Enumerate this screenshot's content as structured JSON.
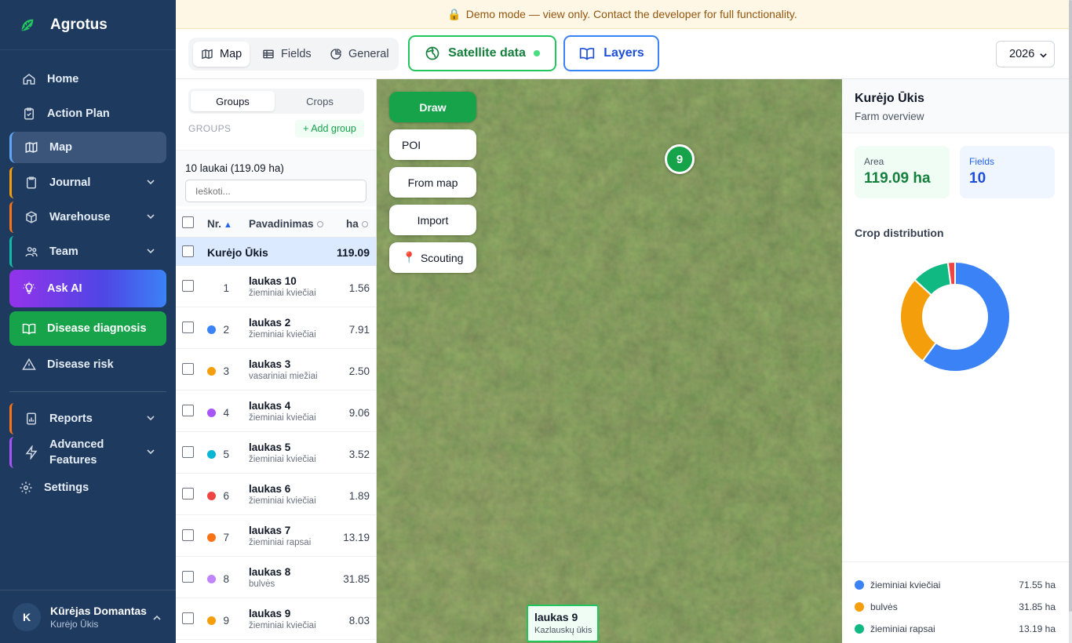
{
  "app": {
    "name": "Agrotus"
  },
  "banner": {
    "text": "Demo mode — view only. Contact the developer for full functionality."
  },
  "sidebar": {
    "items": [
      {
        "label": "Home",
        "icon": "home-icon"
      },
      {
        "label": "Action Plan",
        "icon": "clipboard-icon"
      },
      {
        "label": "Map",
        "icon": "map-icon"
      },
      {
        "label": "Journal",
        "icon": "clipboard-icon"
      },
      {
        "label": "Warehouse",
        "icon": "box-icon"
      },
      {
        "label": "Team",
        "icon": "users-icon"
      },
      {
        "label": "Ask AI",
        "icon": "bulb-icon"
      },
      {
        "label": "Disease diagnosis",
        "icon": "book-icon"
      },
      {
        "label": "Disease risk",
        "icon": "warning-icon"
      },
      {
        "label": "Reports",
        "icon": "report-icon"
      },
      {
        "label": "Advanced",
        "label2": "Features",
        "icon": "bolt-icon"
      },
      {
        "label": "Settings",
        "icon": "gear-icon"
      }
    ],
    "active": "Map"
  },
  "user": {
    "initial": "K",
    "name": "Kūrėjas Domantas",
    "farm": "Kurėjo Ūkis"
  },
  "toolbar": {
    "tabs": [
      {
        "label": "Map"
      },
      {
        "label": "Fields"
      },
      {
        "label": "General"
      }
    ],
    "active_tab": "Map",
    "satellite_label": "Satellite data",
    "layers_label": "Layers",
    "year": "2026"
  },
  "fields_panel": {
    "seg_groups": "Groups",
    "seg_crops": "Crops",
    "groups_label": "GROUPS",
    "add_group": "+ Add group",
    "summary": "10 laukai (119.09 ha)",
    "search_placeholder": "Ieškoti...",
    "headers": {
      "nr": "Nr.",
      "name": "Pavadinimas",
      "ha": "ha"
    },
    "farm_row": {
      "name": "Kurėjo Ūkis",
      "ha": "119.09"
    },
    "rows": [
      {
        "nr": "1",
        "name": "laukas 10",
        "crop": "žieminiai kviečiai",
        "ha": "1.56",
        "color": ""
      },
      {
        "nr": "2",
        "name": "laukas 2",
        "crop": "žieminiai kviečiai",
        "ha": "7.91",
        "color": "#3b82f6"
      },
      {
        "nr": "3",
        "name": "laukas 3",
        "crop": "vasariniai miežiai",
        "ha": "2.50",
        "color": "#f59e0b"
      },
      {
        "nr": "4",
        "name": "laukas 4",
        "crop": "žieminiai kviečiai",
        "ha": "9.06",
        "color": "#a855f7"
      },
      {
        "nr": "5",
        "name": "laukas 5",
        "crop": "žieminiai kviečiai",
        "ha": "3.52",
        "color": "#06b6d4"
      },
      {
        "nr": "6",
        "name": "laukas 6",
        "crop": "žieminiai kviečiai",
        "ha": "1.89",
        "color": "#ef4444"
      },
      {
        "nr": "7",
        "name": "laukas 7",
        "crop": "žieminiai rapsai",
        "ha": "13.19",
        "color": "#f97316"
      },
      {
        "nr": "8",
        "name": "laukas 8",
        "crop": "bulvės",
        "ha": "31.85",
        "color": "#c084fc"
      },
      {
        "nr": "9",
        "name": "laukas 9",
        "crop": "žieminiai kviečiai",
        "ha": "8.03",
        "color": "#f59e0b"
      }
    ]
  },
  "map": {
    "buttons": {
      "draw": "Draw",
      "poi": "POI",
      "from_map": "From map",
      "import": "Import",
      "scouting": "Scouting"
    },
    "marker": "9",
    "label": {
      "title": "laukas 9",
      "subtitle": "Kazlauskų ūkis"
    }
  },
  "overview": {
    "title": "Kurėjo Ūkis",
    "subtitle": "Farm overview",
    "area_label": "Area",
    "area_value": "119.09 ha",
    "fields_label": "Fields",
    "fields_value": "10",
    "crop_title": "Crop distribution",
    "crops": [
      {
        "name": "žieminiai kviečiai",
        "value": "71.55 ha",
        "ha": 71.55,
        "color": "#3b82f6"
      },
      {
        "name": "bulvės",
        "value": "31.85 ha",
        "ha": 31.85,
        "color": "#f59e0b"
      },
      {
        "name": "žieminiai rapsai",
        "value": "13.19 ha",
        "ha": 13.19,
        "color": "#10b981"
      },
      {
        "name": "",
        "value": "",
        "ha": 2.5,
        "color": "#ef4444"
      }
    ]
  },
  "colors": {
    "sidebar": "#1f3a5f",
    "accent_green": "#16a34a",
    "accent_blue": "#3b82f6"
  }
}
